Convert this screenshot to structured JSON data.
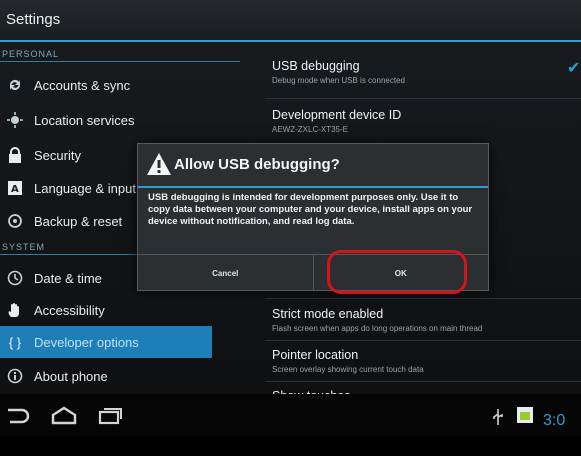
{
  "app": {
    "title": "Settings"
  },
  "sections": {
    "personal": "PERSONAL",
    "system": "SYSTEM"
  },
  "nav": [
    {
      "label": "Accounts & sync",
      "icon": "sync-icon"
    },
    {
      "label": "Location services",
      "icon": "location-icon"
    },
    {
      "label": "Security",
      "icon": "lock-icon"
    },
    {
      "label": "Language & input",
      "icon": "language-icon"
    },
    {
      "label": "Backup & reset",
      "icon": "backup-icon"
    },
    {
      "label": "Date & time",
      "icon": "clock-icon"
    },
    {
      "label": "Accessibility",
      "icon": "hand-icon"
    },
    {
      "label": "Developer options",
      "icon": "braces-icon",
      "selected": true
    },
    {
      "label": "About phone",
      "icon": "info-icon"
    }
  ],
  "settings": [
    {
      "title": "USB debugging",
      "summary": "Debug mode when USB is connected",
      "checked": true
    },
    {
      "title": "Development device ID",
      "summary": "AEWZ-ZXLC-XT35-E"
    },
    {
      "title": "Strict mode enabled",
      "summary": "Flash screen when apps do long operations on main thread"
    },
    {
      "title": "Pointer location",
      "summary": "Screen overlay showing current touch data"
    },
    {
      "title": "Show touches",
      "summary": ""
    }
  ],
  "dialog": {
    "title": "Allow USB debugging?",
    "message": "USB debugging is intended for development purposes only. Use it to copy data between your computer and your device, install apps on your device without notification, and read log data.",
    "cancel_label": "Cancel",
    "ok_label": "OK"
  },
  "statusbar": {
    "time": "3:0"
  },
  "colors": {
    "accent": "#2e9fd2",
    "selected": "#1e7fb8",
    "highlight_ring": "#d7121b"
  }
}
